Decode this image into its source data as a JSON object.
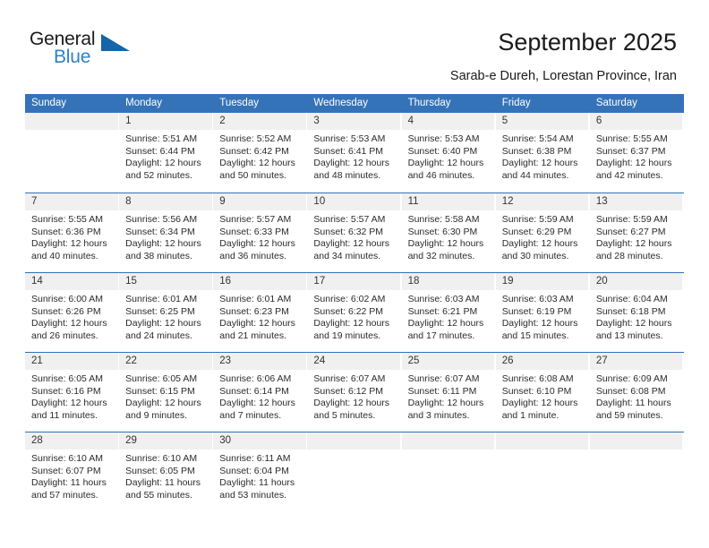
{
  "brand": {
    "name_top": "General",
    "name_bottom": "Blue",
    "accent_color": "#1565a8",
    "blue_text_color": "#2f80c7"
  },
  "header": {
    "title": "September 2025",
    "subtitle": "Sarab-e Dureh, Lorestan Province, Iran"
  },
  "calendar": {
    "header_bg": "#3573b9",
    "daynum_bg": "#f0f0f0",
    "weekdays": [
      "Sunday",
      "Monday",
      "Tuesday",
      "Wednesday",
      "Thursday",
      "Friday",
      "Saturday"
    ],
    "weeks": [
      [
        {
          "day": "",
          "sunrise": "",
          "sunset": "",
          "daylight_1": "",
          "daylight_2": ""
        },
        {
          "day": "1",
          "sunrise": "Sunrise: 5:51 AM",
          "sunset": "Sunset: 6:44 PM",
          "daylight_1": "Daylight: 12 hours",
          "daylight_2": "and 52 minutes."
        },
        {
          "day": "2",
          "sunrise": "Sunrise: 5:52 AM",
          "sunset": "Sunset: 6:42 PM",
          "daylight_1": "Daylight: 12 hours",
          "daylight_2": "and 50 minutes."
        },
        {
          "day": "3",
          "sunrise": "Sunrise: 5:53 AM",
          "sunset": "Sunset: 6:41 PM",
          "daylight_1": "Daylight: 12 hours",
          "daylight_2": "and 48 minutes."
        },
        {
          "day": "4",
          "sunrise": "Sunrise: 5:53 AM",
          "sunset": "Sunset: 6:40 PM",
          "daylight_1": "Daylight: 12 hours",
          "daylight_2": "and 46 minutes."
        },
        {
          "day": "5",
          "sunrise": "Sunrise: 5:54 AM",
          "sunset": "Sunset: 6:38 PM",
          "daylight_1": "Daylight: 12 hours",
          "daylight_2": "and 44 minutes."
        },
        {
          "day": "6",
          "sunrise": "Sunrise: 5:55 AM",
          "sunset": "Sunset: 6:37 PM",
          "daylight_1": "Daylight: 12 hours",
          "daylight_2": "and 42 minutes."
        }
      ],
      [
        {
          "day": "7",
          "sunrise": "Sunrise: 5:55 AM",
          "sunset": "Sunset: 6:36 PM",
          "daylight_1": "Daylight: 12 hours",
          "daylight_2": "and 40 minutes."
        },
        {
          "day": "8",
          "sunrise": "Sunrise: 5:56 AM",
          "sunset": "Sunset: 6:34 PM",
          "daylight_1": "Daylight: 12 hours",
          "daylight_2": "and 38 minutes."
        },
        {
          "day": "9",
          "sunrise": "Sunrise: 5:57 AM",
          "sunset": "Sunset: 6:33 PM",
          "daylight_1": "Daylight: 12 hours",
          "daylight_2": "and 36 minutes."
        },
        {
          "day": "10",
          "sunrise": "Sunrise: 5:57 AM",
          "sunset": "Sunset: 6:32 PM",
          "daylight_1": "Daylight: 12 hours",
          "daylight_2": "and 34 minutes."
        },
        {
          "day": "11",
          "sunrise": "Sunrise: 5:58 AM",
          "sunset": "Sunset: 6:30 PM",
          "daylight_1": "Daylight: 12 hours",
          "daylight_2": "and 32 minutes."
        },
        {
          "day": "12",
          "sunrise": "Sunrise: 5:59 AM",
          "sunset": "Sunset: 6:29 PM",
          "daylight_1": "Daylight: 12 hours",
          "daylight_2": "and 30 minutes."
        },
        {
          "day": "13",
          "sunrise": "Sunrise: 5:59 AM",
          "sunset": "Sunset: 6:27 PM",
          "daylight_1": "Daylight: 12 hours",
          "daylight_2": "and 28 minutes."
        }
      ],
      [
        {
          "day": "14",
          "sunrise": "Sunrise: 6:00 AM",
          "sunset": "Sunset: 6:26 PM",
          "daylight_1": "Daylight: 12 hours",
          "daylight_2": "and 26 minutes."
        },
        {
          "day": "15",
          "sunrise": "Sunrise: 6:01 AM",
          "sunset": "Sunset: 6:25 PM",
          "daylight_1": "Daylight: 12 hours",
          "daylight_2": "and 24 minutes."
        },
        {
          "day": "16",
          "sunrise": "Sunrise: 6:01 AM",
          "sunset": "Sunset: 6:23 PM",
          "daylight_1": "Daylight: 12 hours",
          "daylight_2": "and 21 minutes."
        },
        {
          "day": "17",
          "sunrise": "Sunrise: 6:02 AM",
          "sunset": "Sunset: 6:22 PM",
          "daylight_1": "Daylight: 12 hours",
          "daylight_2": "and 19 minutes."
        },
        {
          "day": "18",
          "sunrise": "Sunrise: 6:03 AM",
          "sunset": "Sunset: 6:21 PM",
          "daylight_1": "Daylight: 12 hours",
          "daylight_2": "and 17 minutes."
        },
        {
          "day": "19",
          "sunrise": "Sunrise: 6:03 AM",
          "sunset": "Sunset: 6:19 PM",
          "daylight_1": "Daylight: 12 hours",
          "daylight_2": "and 15 minutes."
        },
        {
          "day": "20",
          "sunrise": "Sunrise: 6:04 AM",
          "sunset": "Sunset: 6:18 PM",
          "daylight_1": "Daylight: 12 hours",
          "daylight_2": "and 13 minutes."
        }
      ],
      [
        {
          "day": "21",
          "sunrise": "Sunrise: 6:05 AM",
          "sunset": "Sunset: 6:16 PM",
          "daylight_1": "Daylight: 12 hours",
          "daylight_2": "and 11 minutes."
        },
        {
          "day": "22",
          "sunrise": "Sunrise: 6:05 AM",
          "sunset": "Sunset: 6:15 PM",
          "daylight_1": "Daylight: 12 hours",
          "daylight_2": "and 9 minutes."
        },
        {
          "day": "23",
          "sunrise": "Sunrise: 6:06 AM",
          "sunset": "Sunset: 6:14 PM",
          "daylight_1": "Daylight: 12 hours",
          "daylight_2": "and 7 minutes."
        },
        {
          "day": "24",
          "sunrise": "Sunrise: 6:07 AM",
          "sunset": "Sunset: 6:12 PM",
          "daylight_1": "Daylight: 12 hours",
          "daylight_2": "and 5 minutes."
        },
        {
          "day": "25",
          "sunrise": "Sunrise: 6:07 AM",
          "sunset": "Sunset: 6:11 PM",
          "daylight_1": "Daylight: 12 hours",
          "daylight_2": "and 3 minutes."
        },
        {
          "day": "26",
          "sunrise": "Sunrise: 6:08 AM",
          "sunset": "Sunset: 6:10 PM",
          "daylight_1": "Daylight: 12 hours",
          "daylight_2": "and 1 minute."
        },
        {
          "day": "27",
          "sunrise": "Sunrise: 6:09 AM",
          "sunset": "Sunset: 6:08 PM",
          "daylight_1": "Daylight: 11 hours",
          "daylight_2": "and 59 minutes."
        }
      ],
      [
        {
          "day": "28",
          "sunrise": "Sunrise: 6:10 AM",
          "sunset": "Sunset: 6:07 PM",
          "daylight_1": "Daylight: 11 hours",
          "daylight_2": "and 57 minutes."
        },
        {
          "day": "29",
          "sunrise": "Sunrise: 6:10 AM",
          "sunset": "Sunset: 6:05 PM",
          "daylight_1": "Daylight: 11 hours",
          "daylight_2": "and 55 minutes."
        },
        {
          "day": "30",
          "sunrise": "Sunrise: 6:11 AM",
          "sunset": "Sunset: 6:04 PM",
          "daylight_1": "Daylight: 11 hours",
          "daylight_2": "and 53 minutes."
        },
        {
          "day": "",
          "sunrise": "",
          "sunset": "",
          "daylight_1": "",
          "daylight_2": ""
        },
        {
          "day": "",
          "sunrise": "",
          "sunset": "",
          "daylight_1": "",
          "daylight_2": ""
        },
        {
          "day": "",
          "sunrise": "",
          "sunset": "",
          "daylight_1": "",
          "daylight_2": ""
        },
        {
          "day": "",
          "sunrise": "",
          "sunset": "",
          "daylight_1": "",
          "daylight_2": ""
        }
      ]
    ]
  }
}
